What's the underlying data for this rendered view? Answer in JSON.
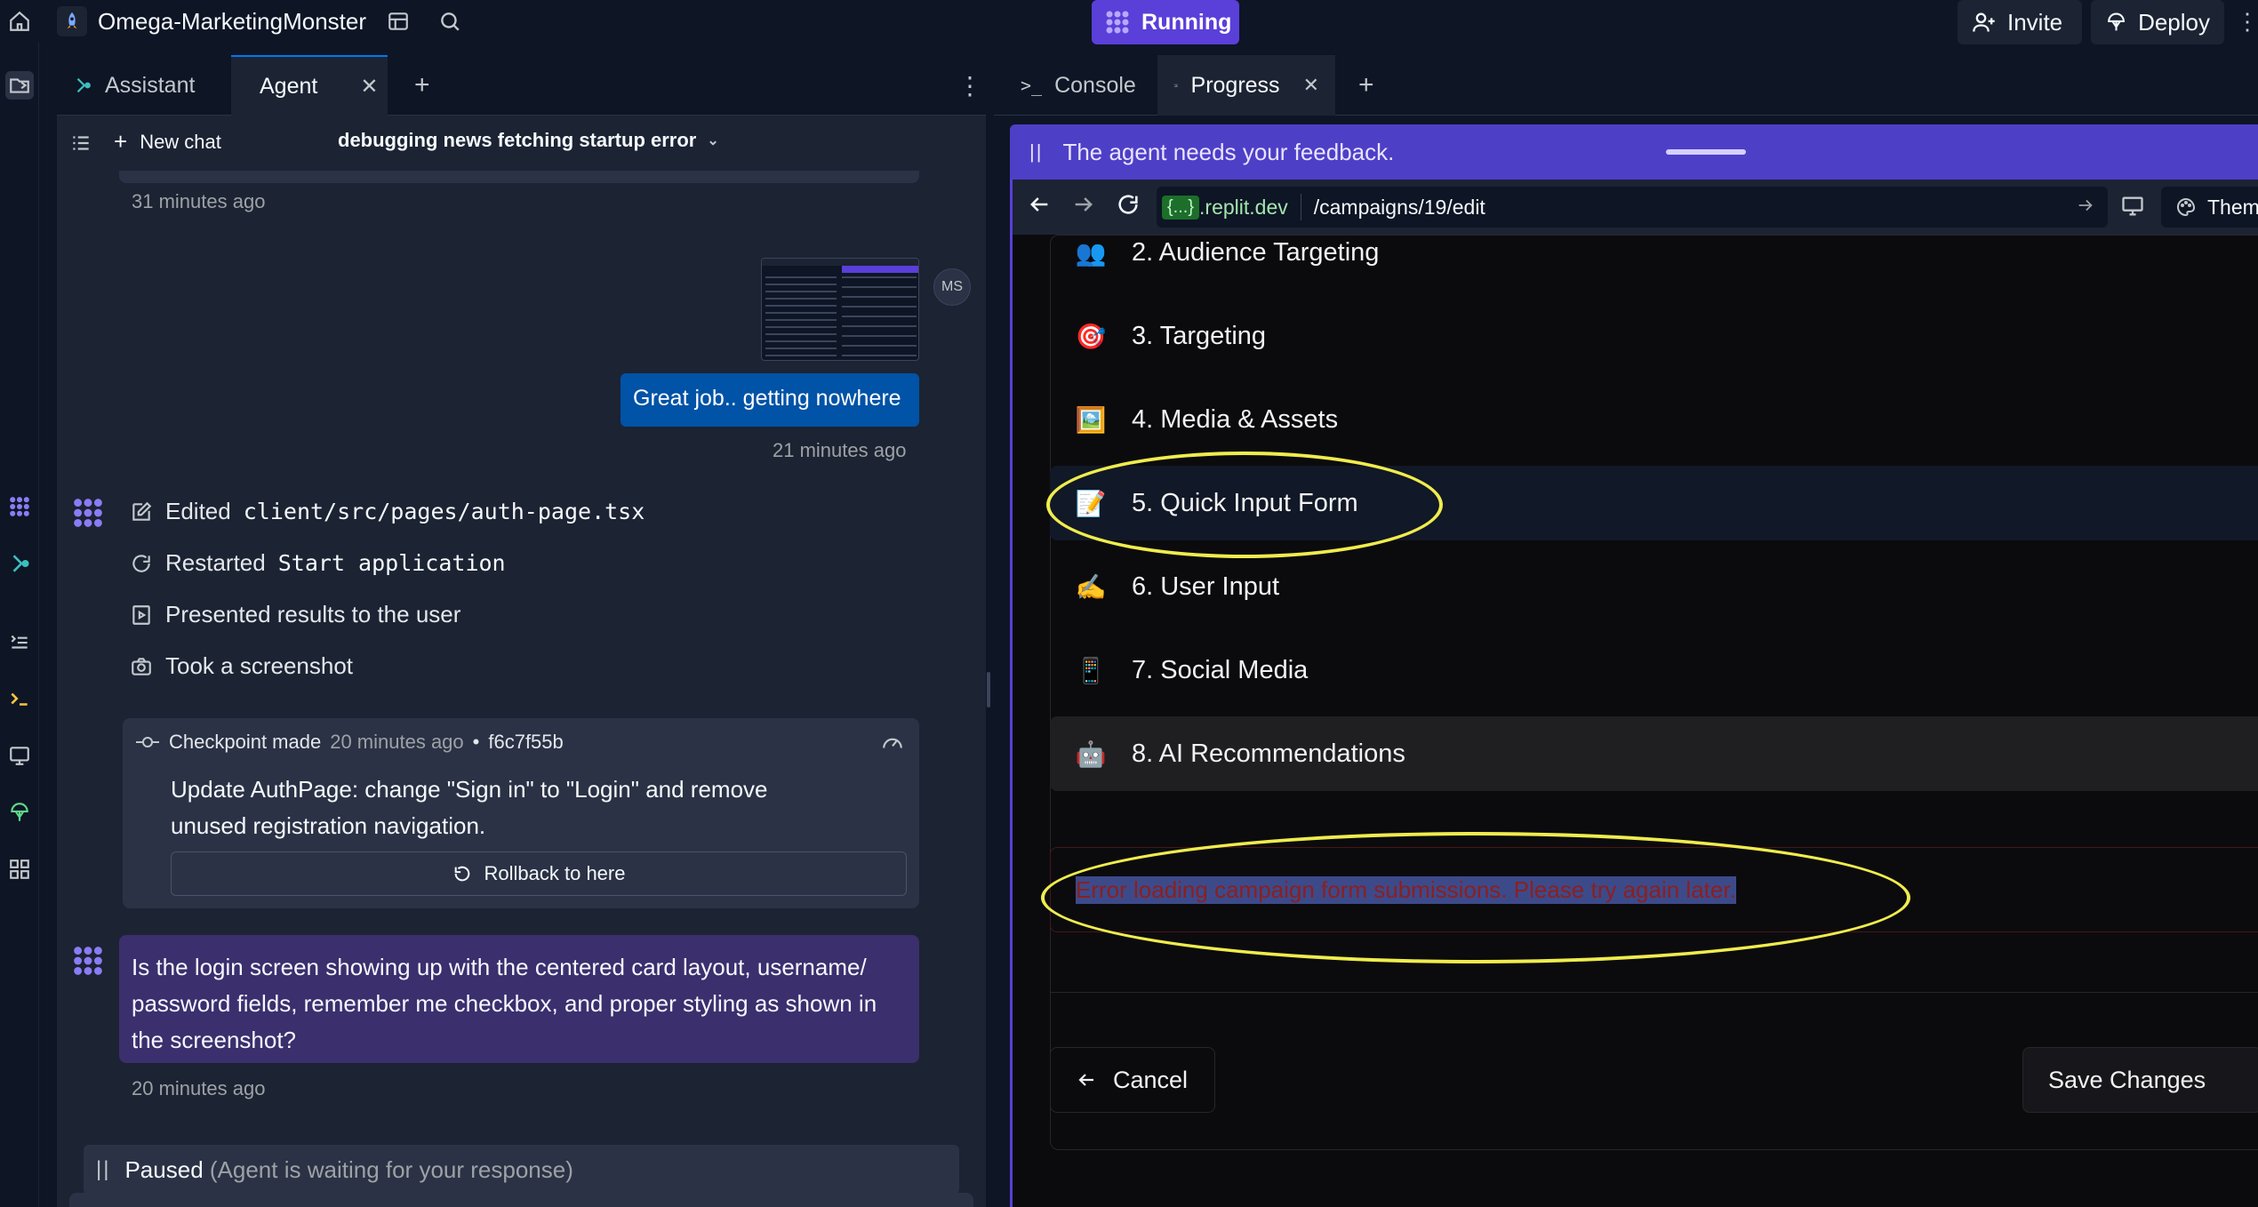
{
  "topbar": {
    "project_name": "Omega-MarketingMonster",
    "status": "Running",
    "invite": "Invite",
    "deploy": "Deploy"
  },
  "left_pane": {
    "tabs": [
      "Assistant",
      "Agent"
    ],
    "new_chat": "New chat",
    "chat_title": "debugging news fetching startup error",
    "messages": {
      "time1": "31 minutes ago",
      "user_avatar": "MS",
      "user_message": "Great job.. getting nowhere",
      "time2": "21 minutes ago",
      "actions": [
        {
          "label": "Edited",
          "code": "client/src/pages/auth-page.tsx"
        },
        {
          "label": "Restarted",
          "code": "Start application"
        },
        {
          "label": "Presented results to the user",
          "code": ""
        },
        {
          "label": "Took a screenshot",
          "code": ""
        }
      ],
      "checkpoint": {
        "label": "Checkpoint made",
        "time": "20 minutes ago",
        "hash": "f6c7f55b",
        "description": "Update AuthPage: change \"Sign in\" to \"Login\" and remove unused registration navigation.",
        "rollback": "Rollback to here"
      },
      "agent_question": "Is the login screen showing up with the centered card layout, username/ password fields, remember me checkbox, and proper styling as shown in the screenshot?",
      "time3": "20 minutes ago"
    },
    "paused": "Paused",
    "paused_note": "(Agent is waiting for your response)"
  },
  "right_pane": {
    "tabs": [
      "Console",
      "Progress"
    ],
    "feedback": "The agent needs your feedback.",
    "url_domain_badge": "{...}",
    "url_domain": ".replit.dev",
    "url_path": "/campaigns/19/edit",
    "theme": "Theme",
    "steps": [
      {
        "icon": "👥",
        "label": "2. Audience Targeting"
      },
      {
        "icon": "🎯",
        "label": "3. Targeting"
      },
      {
        "icon": "🖼️",
        "label": "4. Media & Assets"
      },
      {
        "icon": "📝",
        "label": "5. Quick Input Form"
      },
      {
        "icon": "✍️",
        "label": "6. User Input"
      },
      {
        "icon": "📱",
        "label": "7. Social Media"
      },
      {
        "icon": "🤖",
        "label": "8. AI Recommendations"
      }
    ],
    "error": "Error loading campaign form submissions. Please try again later.",
    "cancel": "Cancel",
    "save": "Save Changes"
  },
  "colors": {
    "accent": "#5a3fd9",
    "user_bubble": "#0053a6",
    "highlight": "#f0ec4d",
    "error_text": "#8a2020"
  }
}
